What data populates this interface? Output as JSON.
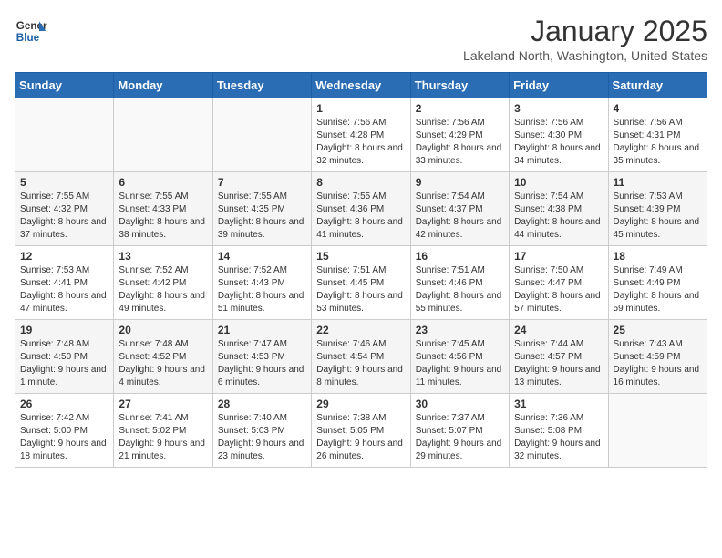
{
  "header": {
    "logo_line1": "General",
    "logo_line2": "Blue",
    "month": "January 2025",
    "location": "Lakeland North, Washington, United States"
  },
  "weekdays": [
    "Sunday",
    "Monday",
    "Tuesday",
    "Wednesday",
    "Thursday",
    "Friday",
    "Saturday"
  ],
  "weeks": [
    [
      {
        "day": "",
        "info": ""
      },
      {
        "day": "",
        "info": ""
      },
      {
        "day": "",
        "info": ""
      },
      {
        "day": "1",
        "info": "Sunrise: 7:56 AM\nSunset: 4:28 PM\nDaylight: 8 hours and 32 minutes."
      },
      {
        "day": "2",
        "info": "Sunrise: 7:56 AM\nSunset: 4:29 PM\nDaylight: 8 hours and 33 minutes."
      },
      {
        "day": "3",
        "info": "Sunrise: 7:56 AM\nSunset: 4:30 PM\nDaylight: 8 hours and 34 minutes."
      },
      {
        "day": "4",
        "info": "Sunrise: 7:56 AM\nSunset: 4:31 PM\nDaylight: 8 hours and 35 minutes."
      }
    ],
    [
      {
        "day": "5",
        "info": "Sunrise: 7:55 AM\nSunset: 4:32 PM\nDaylight: 8 hours and 37 minutes."
      },
      {
        "day": "6",
        "info": "Sunrise: 7:55 AM\nSunset: 4:33 PM\nDaylight: 8 hours and 38 minutes."
      },
      {
        "day": "7",
        "info": "Sunrise: 7:55 AM\nSunset: 4:35 PM\nDaylight: 8 hours and 39 minutes."
      },
      {
        "day": "8",
        "info": "Sunrise: 7:55 AM\nSunset: 4:36 PM\nDaylight: 8 hours and 41 minutes."
      },
      {
        "day": "9",
        "info": "Sunrise: 7:54 AM\nSunset: 4:37 PM\nDaylight: 8 hours and 42 minutes."
      },
      {
        "day": "10",
        "info": "Sunrise: 7:54 AM\nSunset: 4:38 PM\nDaylight: 8 hours and 44 minutes."
      },
      {
        "day": "11",
        "info": "Sunrise: 7:53 AM\nSunset: 4:39 PM\nDaylight: 8 hours and 45 minutes."
      }
    ],
    [
      {
        "day": "12",
        "info": "Sunrise: 7:53 AM\nSunset: 4:41 PM\nDaylight: 8 hours and 47 minutes."
      },
      {
        "day": "13",
        "info": "Sunrise: 7:52 AM\nSunset: 4:42 PM\nDaylight: 8 hours and 49 minutes."
      },
      {
        "day": "14",
        "info": "Sunrise: 7:52 AM\nSunset: 4:43 PM\nDaylight: 8 hours and 51 minutes."
      },
      {
        "day": "15",
        "info": "Sunrise: 7:51 AM\nSunset: 4:45 PM\nDaylight: 8 hours and 53 minutes."
      },
      {
        "day": "16",
        "info": "Sunrise: 7:51 AM\nSunset: 4:46 PM\nDaylight: 8 hours and 55 minutes."
      },
      {
        "day": "17",
        "info": "Sunrise: 7:50 AM\nSunset: 4:47 PM\nDaylight: 8 hours and 57 minutes."
      },
      {
        "day": "18",
        "info": "Sunrise: 7:49 AM\nSunset: 4:49 PM\nDaylight: 8 hours and 59 minutes."
      }
    ],
    [
      {
        "day": "19",
        "info": "Sunrise: 7:48 AM\nSunset: 4:50 PM\nDaylight: 9 hours and 1 minute."
      },
      {
        "day": "20",
        "info": "Sunrise: 7:48 AM\nSunset: 4:52 PM\nDaylight: 9 hours and 4 minutes."
      },
      {
        "day": "21",
        "info": "Sunrise: 7:47 AM\nSunset: 4:53 PM\nDaylight: 9 hours and 6 minutes."
      },
      {
        "day": "22",
        "info": "Sunrise: 7:46 AM\nSunset: 4:54 PM\nDaylight: 9 hours and 8 minutes."
      },
      {
        "day": "23",
        "info": "Sunrise: 7:45 AM\nSunset: 4:56 PM\nDaylight: 9 hours and 11 minutes."
      },
      {
        "day": "24",
        "info": "Sunrise: 7:44 AM\nSunset: 4:57 PM\nDaylight: 9 hours and 13 minutes."
      },
      {
        "day": "25",
        "info": "Sunrise: 7:43 AM\nSunset: 4:59 PM\nDaylight: 9 hours and 16 minutes."
      }
    ],
    [
      {
        "day": "26",
        "info": "Sunrise: 7:42 AM\nSunset: 5:00 PM\nDaylight: 9 hours and 18 minutes."
      },
      {
        "day": "27",
        "info": "Sunrise: 7:41 AM\nSunset: 5:02 PM\nDaylight: 9 hours and 21 minutes."
      },
      {
        "day": "28",
        "info": "Sunrise: 7:40 AM\nSunset: 5:03 PM\nDaylight: 9 hours and 23 minutes."
      },
      {
        "day": "29",
        "info": "Sunrise: 7:38 AM\nSunset: 5:05 PM\nDaylight: 9 hours and 26 minutes."
      },
      {
        "day": "30",
        "info": "Sunrise: 7:37 AM\nSunset: 5:07 PM\nDaylight: 9 hours and 29 minutes."
      },
      {
        "day": "31",
        "info": "Sunrise: 7:36 AM\nSunset: 5:08 PM\nDaylight: 9 hours and 32 minutes."
      },
      {
        "day": "",
        "info": ""
      }
    ]
  ]
}
